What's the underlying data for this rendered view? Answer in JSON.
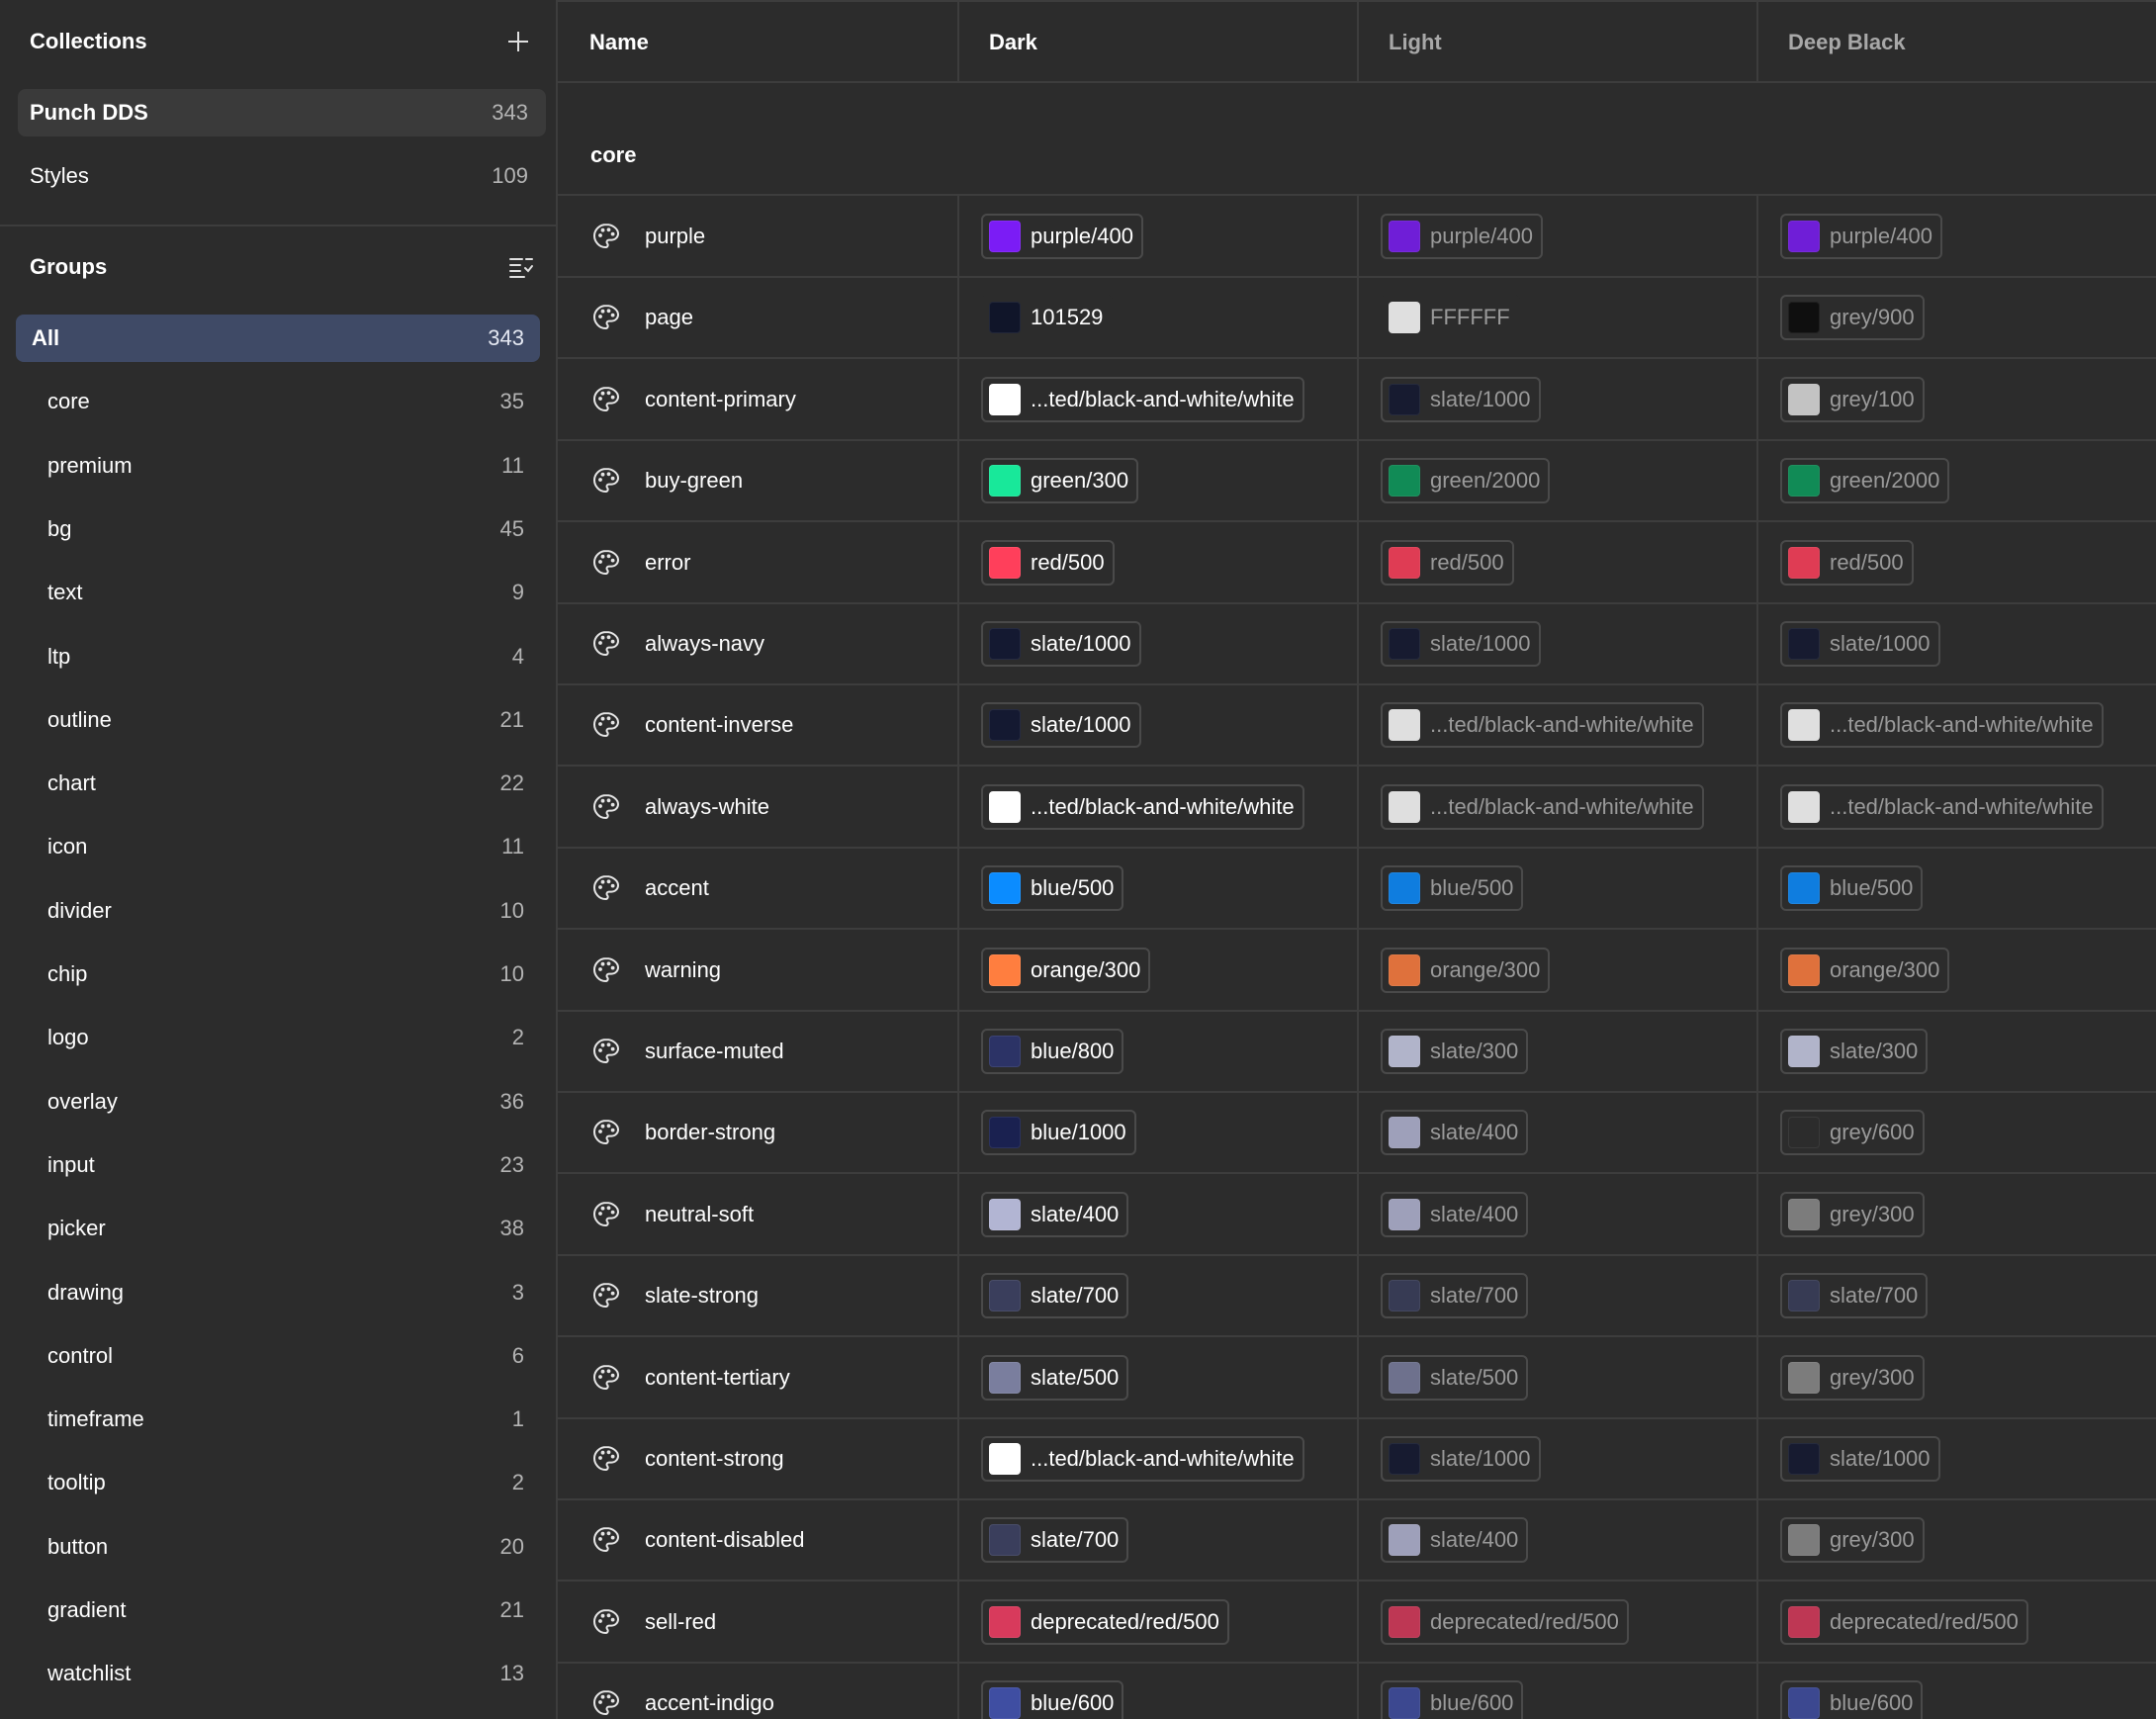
{
  "colors": {
    "purple_400": "#7b1cf5",
    "navy_101529": "#101529",
    "white": "#ffffff",
    "grey_900": "#0b0b0b",
    "slate_1000": "#141931",
    "grey_100": "#dedede",
    "green_300": "#18e89a",
    "green_2000": "#0d9c5e",
    "red_500": "#ff3f5b",
    "blue_500": "#0b8cff",
    "orange_300": "#ff7e3f",
    "blue_800": "#2c3366",
    "slate_300": "#c9cce6",
    "blue_1000": "#1a2150",
    "slate_400": "#b2b5d3",
    "grey_600": "#2d2d2d",
    "grey_300": "#8a8a8a",
    "slate_700": "#3a3e5c",
    "slate_500": "#7a7e9e",
    "deprecated_red_500": "#d83a5c",
    "blue_600": "#3f4ea2"
  },
  "sidebar": {
    "collections_title": "Collections",
    "add_icon": "plus-icon",
    "collections": [
      {
        "label": "Punch DDS",
        "count": "343"
      },
      {
        "label": "Styles",
        "count": "109"
      }
    ],
    "groups_title": "Groups",
    "filter_icon": "filter-list-icon",
    "groups": [
      {
        "label": "All",
        "count": "343"
      },
      {
        "label": "core",
        "count": "35"
      },
      {
        "label": "premium",
        "count": "11"
      },
      {
        "label": "bg",
        "count": "45"
      },
      {
        "label": "text",
        "count": "9"
      },
      {
        "label": "ltp",
        "count": "4"
      },
      {
        "label": "outline",
        "count": "21"
      },
      {
        "label": "chart",
        "count": "22"
      },
      {
        "label": "icon",
        "count": "11"
      },
      {
        "label": "divider",
        "count": "10"
      },
      {
        "label": "chip",
        "count": "10"
      },
      {
        "label": "logo",
        "count": "2"
      },
      {
        "label": "overlay",
        "count": "36"
      },
      {
        "label": "input",
        "count": "23"
      },
      {
        "label": "picker",
        "count": "38"
      },
      {
        "label": "drawing",
        "count": "3"
      },
      {
        "label": "control",
        "count": "6"
      },
      {
        "label": "timeframe",
        "count": "1"
      },
      {
        "label": "tooltip",
        "count": "2"
      },
      {
        "label": "button",
        "count": "20"
      },
      {
        "label": "gradient",
        "count": "21"
      },
      {
        "label": "watchlist",
        "count": "13"
      }
    ]
  },
  "table": {
    "headers": [
      "Name",
      "Dark",
      "Light",
      "Deep Black"
    ],
    "group_label": "core",
    "row_icon": "palette-icon",
    "rows": [
      {
        "name": "purple",
        "dark": {
          "text": "purple/400",
          "color": "#7b1cf5"
        },
        "light": {
          "text": "purple/400",
          "color": "#7b1cf5"
        },
        "black": {
          "text": "purple/400",
          "color": "#7b1cf5"
        }
      },
      {
        "name": "page",
        "dark": {
          "text": "101529",
          "color": "#101529",
          "plain": true
        },
        "light": {
          "text": "FFFFFF",
          "color": "#ffffff",
          "plain": true
        },
        "black": {
          "text": "grey/900",
          "color": "#0b0b0b"
        }
      },
      {
        "name": "content-primary",
        "dark": {
          "text": "...ted/black-and-white/white",
          "color": "#ffffff"
        },
        "light": {
          "text": "slate/1000",
          "color": "#141931"
        },
        "black": {
          "text": "grey/100",
          "color": "#dedede"
        }
      },
      {
        "name": "buy-green",
        "dark": {
          "text": "green/300",
          "color": "#18e89a"
        },
        "light": {
          "text": "green/2000",
          "color": "#0d9c5e"
        },
        "black": {
          "text": "green/2000",
          "color": "#0d9c5e"
        }
      },
      {
        "name": "error",
        "dark": {
          "text": "red/500",
          "color": "#ff3f5b"
        },
        "light": {
          "text": "red/500",
          "color": "#ff3f5b"
        },
        "black": {
          "text": "red/500",
          "color": "#ff3f5b"
        }
      },
      {
        "name": "always-navy",
        "dark": {
          "text": "slate/1000",
          "color": "#141931"
        },
        "light": {
          "text": "slate/1000",
          "color": "#141931"
        },
        "black": {
          "text": "slate/1000",
          "color": "#141931"
        }
      },
      {
        "name": "content-inverse",
        "dark": {
          "text": "slate/1000",
          "color": "#141931"
        },
        "light": {
          "text": "...ted/black-and-white/white",
          "color": "#ffffff"
        },
        "black": {
          "text": "...ted/black-and-white/white",
          "color": "#ffffff"
        }
      },
      {
        "name": "always-white",
        "dark": {
          "text": "...ted/black-and-white/white",
          "color": "#ffffff"
        },
        "light": {
          "text": "...ted/black-and-white/white",
          "color": "#ffffff"
        },
        "black": {
          "text": "...ted/black-and-white/white",
          "color": "#ffffff"
        }
      },
      {
        "name": "accent",
        "dark": {
          "text": "blue/500",
          "color": "#0b8cff"
        },
        "light": {
          "text": "blue/500",
          "color": "#0b8cff"
        },
        "black": {
          "text": "blue/500",
          "color": "#0b8cff"
        }
      },
      {
        "name": "warning",
        "dark": {
          "text": "orange/300",
          "color": "#ff7e3f"
        },
        "light": {
          "text": "orange/300",
          "color": "#ff7e3f"
        },
        "black": {
          "text": "orange/300",
          "color": "#ff7e3f"
        }
      },
      {
        "name": "surface-muted",
        "dark": {
          "text": "blue/800",
          "color": "#2c3366"
        },
        "light": {
          "text": "slate/300",
          "color": "#c9cce6"
        },
        "black": {
          "text": "slate/300",
          "color": "#c9cce6"
        }
      },
      {
        "name": "border-strong",
        "dark": {
          "text": "blue/1000",
          "color": "#1a2150"
        },
        "light": {
          "text": "slate/400",
          "color": "#b2b5d3"
        },
        "black": {
          "text": "grey/600",
          "color": "#2d2d2d"
        }
      },
      {
        "name": "neutral-soft",
        "dark": {
          "text": "slate/400",
          "color": "#b2b5d3"
        },
        "light": {
          "text": "slate/400",
          "color": "#b2b5d3"
        },
        "black": {
          "text": "grey/300",
          "color": "#8a8a8a"
        }
      },
      {
        "name": "slate-strong",
        "dark": {
          "text": "slate/700",
          "color": "#3a3e5c"
        },
        "light": {
          "text": "slate/700",
          "color": "#3a3e5c"
        },
        "black": {
          "text": "slate/700",
          "color": "#3a3e5c"
        }
      },
      {
        "name": "content-tertiary",
        "dark": {
          "text": "slate/500",
          "color": "#7a7e9e"
        },
        "light": {
          "text": "slate/500",
          "color": "#7a7e9e"
        },
        "black": {
          "text": "grey/300",
          "color": "#8a8a8a"
        }
      },
      {
        "name": "content-strong",
        "dark": {
          "text": "...ted/black-and-white/white",
          "color": "#ffffff"
        },
        "light": {
          "text": "slate/1000",
          "color": "#141931"
        },
        "black": {
          "text": "slate/1000",
          "color": "#141931"
        }
      },
      {
        "name": "content-disabled",
        "dark": {
          "text": "slate/700",
          "color": "#3a3e5c"
        },
        "light": {
          "text": "slate/400",
          "color": "#b2b5d3"
        },
        "black": {
          "text": "grey/300",
          "color": "#8a8a8a"
        }
      },
      {
        "name": "sell-red",
        "dark": {
          "text": "deprecated/red/500",
          "color": "#d83a5c"
        },
        "light": {
          "text": "deprecated/red/500",
          "color": "#d83a5c"
        },
        "black": {
          "text": "deprecated/red/500",
          "color": "#d83a5c"
        }
      },
      {
        "name": "accent-indigo",
        "dark": {
          "text": "blue/600",
          "color": "#3f4ea2"
        },
        "light": {
          "text": "blue/600",
          "color": "#3f4ea2"
        },
        "black": {
          "text": "blue/600",
          "color": "#3f4ea2"
        }
      }
    ]
  }
}
